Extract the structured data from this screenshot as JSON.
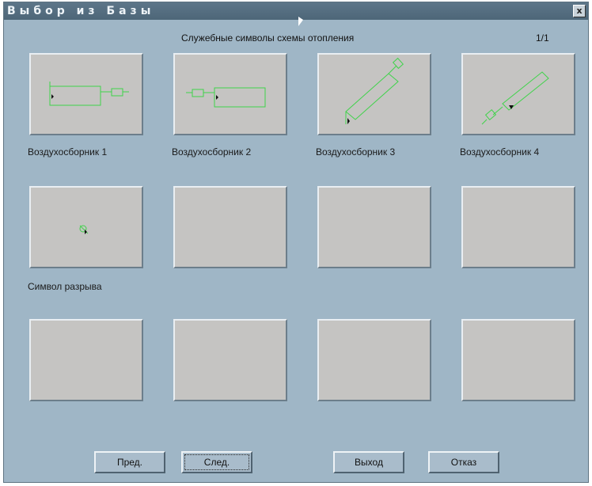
{
  "window": {
    "title": "Выбор из Базы",
    "close_glyph": "x"
  },
  "header": {
    "group_title": "Служебные символы схемы отопления",
    "page": "1/1"
  },
  "items": [
    {
      "label": "Воздухосборник 1",
      "icon": "air-collector-1-icon"
    },
    {
      "label": "Воздухосборник 2",
      "icon": "air-collector-2-icon"
    },
    {
      "label": "Воздухосборник 3",
      "icon": "air-collector-3-icon"
    },
    {
      "label": "Воздухосборник 4",
      "icon": "air-collector-4-icon"
    },
    {
      "label": "Символ разрыва",
      "icon": "break-symbol-icon"
    }
  ],
  "buttons": {
    "prev": "Пред.",
    "next": "След.",
    "exit": "Выход",
    "cancel": "Отказ"
  },
  "colors": {
    "symbol": "#3fd34a",
    "window_bg": "#9fb6c6",
    "cell_bg": "#c5c4c2"
  }
}
